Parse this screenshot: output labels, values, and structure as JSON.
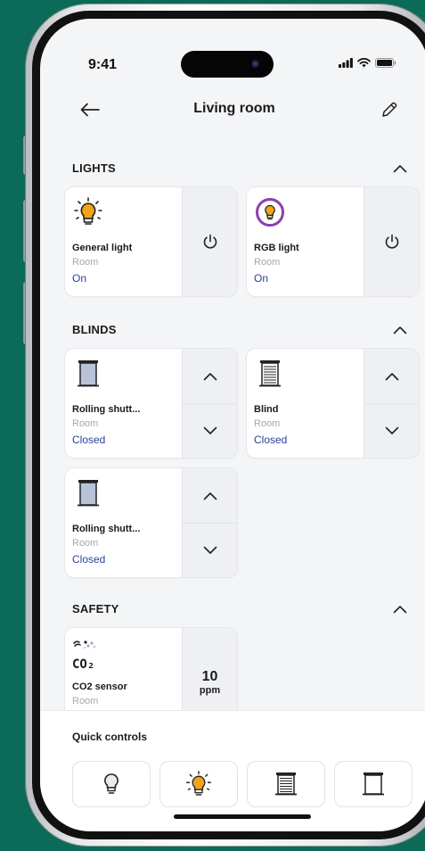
{
  "status_bar": {
    "time": "9:41"
  },
  "header": {
    "title": "Living room"
  },
  "sections": {
    "lights": {
      "title": "LIGHTS",
      "cards": [
        {
          "name": "General light",
          "room": "Room",
          "status": "On"
        },
        {
          "name": "RGB light",
          "room": "Room",
          "status": "On"
        }
      ]
    },
    "blinds": {
      "title": "BLINDS",
      "cards": [
        {
          "name": "Rolling shutt...",
          "room": "Room",
          "status": "Closed"
        },
        {
          "name": "Blind",
          "room": "Room",
          "status": "Closed"
        },
        {
          "name": "Rolling shutt...",
          "room": "Room",
          "status": "Closed"
        }
      ]
    },
    "safety": {
      "title": "SAFETY",
      "cards": [
        {
          "name": "CO2 sensor",
          "room": "Room",
          "icon_label": "CO₂",
          "value": "10",
          "unit": "ppm"
        }
      ]
    }
  },
  "quick_controls": {
    "title": "Quick controls",
    "items": [
      {
        "icon": "bulb-off-icon"
      },
      {
        "icon": "bulb-on-icon"
      },
      {
        "icon": "blind-icon"
      },
      {
        "icon": "rolling-shutter-icon"
      }
    ]
  },
  "colors": {
    "background": "#0b6b58",
    "accent_status": "#27439a",
    "bulb_on": "#f2a41a",
    "rgb_ring": "#8b3fb0",
    "shutter_fill": "#b9c3d8"
  }
}
